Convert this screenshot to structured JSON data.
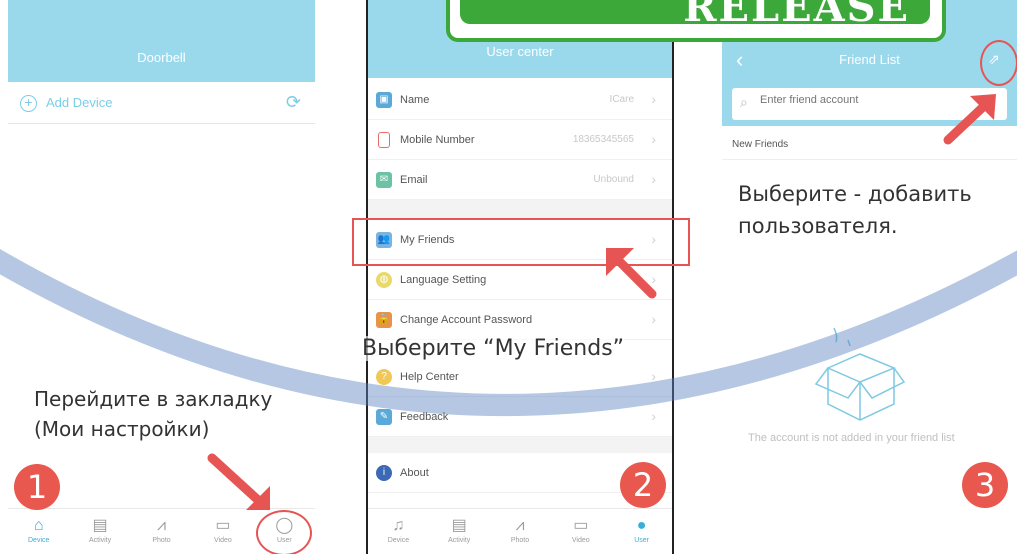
{
  "banner": {
    "text": "RELEASE"
  },
  "colors": {
    "header": "#9ad8ec",
    "accent": "#3aaed8",
    "annotation_red": "#e65454",
    "banner_green": "#3da83a"
  },
  "phone1": {
    "title": "Doorbell",
    "add_device": "Add Device",
    "caption_line1": "Перейдите в закладку",
    "caption_line2": "(Мои настройки)",
    "step": "1",
    "tabs": [
      {
        "label": "Device",
        "icon": "home-icon"
      },
      {
        "label": "Activity",
        "icon": "calendar-icon"
      },
      {
        "label": "Photo",
        "icon": "chart-icon"
      },
      {
        "label": "Video",
        "icon": "video-icon"
      },
      {
        "label": "User",
        "icon": "user-icon"
      }
    ]
  },
  "phone2": {
    "title": "User center",
    "rows": [
      {
        "label": "Name",
        "value": "ICare"
      },
      {
        "label": "Mobile Number",
        "value": "18365345565"
      },
      {
        "label": "Email",
        "value": "Unbound"
      },
      {
        "label": "My Friends",
        "value": ""
      },
      {
        "label": "Language Setting",
        "value": ""
      },
      {
        "label": "Change Account Password",
        "value": ""
      },
      {
        "label": "Help Center",
        "value": ""
      },
      {
        "label": "Feedback",
        "value": ""
      },
      {
        "label": "About",
        "value": ""
      }
    ],
    "caption": "Выберите “My Friends”",
    "step": "2",
    "tabs": [
      {
        "label": "Device",
        "icon": "bell-icon"
      },
      {
        "label": "Activity",
        "icon": "calendar-icon"
      },
      {
        "label": "Photo",
        "icon": "chart-icon"
      },
      {
        "label": "Video",
        "icon": "video-icon"
      },
      {
        "label": "User",
        "icon": "user-icon"
      }
    ]
  },
  "phone3": {
    "title": "Friend List",
    "search_placeholder": "Enter friend account",
    "new_friends": "New Friends",
    "caption_line1": "Выберите - добавить",
    "caption_line2": "пользователя.",
    "empty_text": "The account is not added in your friend list",
    "step": "3"
  }
}
